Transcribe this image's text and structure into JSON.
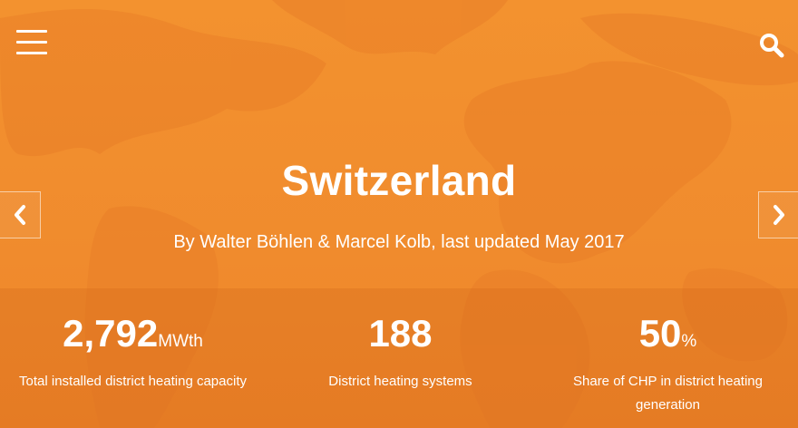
{
  "header": {
    "menu_icon": "hamburger-menu-icon",
    "search_icon": "search-icon"
  },
  "hero": {
    "title": "Switzerland",
    "subtitle": "By Walter Böhlen & Marcel Kolb, last updated May 2017",
    "prev_icon": "chevron-left-icon",
    "next_icon": "chevron-right-icon"
  },
  "stats": [
    {
      "value": "2,792",
      "unit": "MWth",
      "label": "Total installed district heating capacity"
    },
    {
      "value": "188",
      "unit": "",
      "label": "District heating systems"
    },
    {
      "value": "50",
      "unit": "%",
      "label": "Share of CHP in district heating generation"
    }
  ],
  "colors": {
    "accent": "#f28a30",
    "text": "#ffffff"
  }
}
